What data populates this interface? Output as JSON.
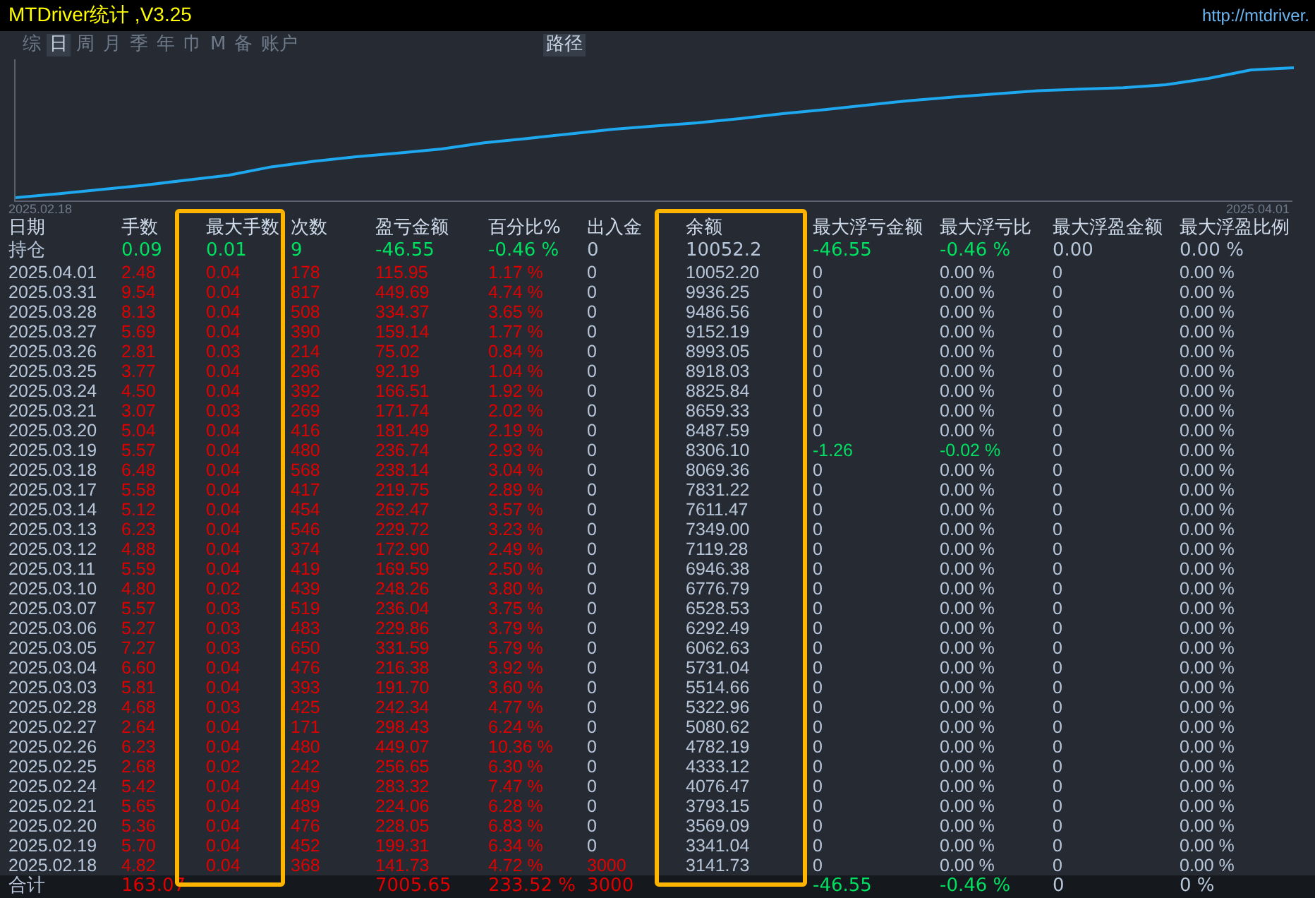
{
  "window": {
    "title": "MTDriver统计 ,V3.25",
    "url": "http://mtdriver."
  },
  "tabs": [
    {
      "label": "综",
      "selected": false
    },
    {
      "label": "日",
      "selected": true
    },
    {
      "label": "周",
      "selected": false
    },
    {
      "label": "月",
      "selected": false
    },
    {
      "label": "季",
      "selected": false
    },
    {
      "label": "年",
      "selected": false
    },
    {
      "label": "巾",
      "selected": false
    },
    {
      "label": "M",
      "selected": false
    },
    {
      "label": "备",
      "selected": false
    },
    {
      "label": "账户",
      "selected": false
    }
  ],
  "path_button": {
    "label": "路径",
    "selected": true
  },
  "chart": {
    "start_label": "2025.02.18",
    "end_label": "2025.04.01"
  },
  "table": {
    "columns": [
      {
        "label": "日期",
        "highlighted": false
      },
      {
        "label": "手数",
        "highlighted": false
      },
      {
        "label": "最大手数",
        "highlighted": true
      },
      {
        "label": "次数",
        "highlighted": false
      },
      {
        "label": "盈亏金额",
        "highlighted": false
      },
      {
        "label": "百分比%",
        "highlighted": false
      },
      {
        "label": "出入金",
        "highlighted": false
      },
      {
        "label": "余额",
        "highlighted": true
      },
      {
        "label": "最大浮亏金额",
        "highlighted": false
      },
      {
        "label": "最大浮亏比",
        "highlighted": false
      },
      {
        "label": "最大浮盈金额",
        "highlighted": false
      },
      {
        "label": "最大浮盈比例",
        "highlighted": false
      }
    ],
    "rows": [
      {
        "kind": "position",
        "cells": [
          "持仓",
          "0.09",
          "0.01",
          "9",
          "-46.55",
          "-0.46 %",
          "0",
          "10052.2",
          "-46.55",
          "-0.46 %",
          "0.00",
          "0.00 %"
        ]
      },
      {
        "kind": "day",
        "cells": [
          "2025.04.01",
          "2.48",
          "0.04",
          "178",
          "115.95",
          "1.17 %",
          "0",
          "10052.20",
          "0",
          "0.00 %",
          "0",
          "0.00 %"
        ]
      },
      {
        "kind": "day",
        "cells": [
          "2025.03.31",
          "9.54",
          "0.04",
          "817",
          "449.69",
          "4.74 %",
          "0",
          "9936.25",
          "0",
          "0.00 %",
          "0",
          "0.00 %"
        ]
      },
      {
        "kind": "day",
        "cells": [
          "2025.03.28",
          "8.13",
          "0.04",
          "508",
          "334.37",
          "3.65 %",
          "0",
          "9486.56",
          "0",
          "0.00 %",
          "0",
          "0.00 %"
        ]
      },
      {
        "kind": "day",
        "cells": [
          "2025.03.27",
          "5.69",
          "0.04",
          "390",
          "159.14",
          "1.77 %",
          "0",
          "9152.19",
          "0",
          "0.00 %",
          "0",
          "0.00 %"
        ]
      },
      {
        "kind": "day",
        "cells": [
          "2025.03.26",
          "2.81",
          "0.03",
          "214",
          "75.02",
          "0.84 %",
          "0",
          "8993.05",
          "0",
          "0.00 %",
          "0",
          "0.00 %"
        ]
      },
      {
        "kind": "day",
        "cells": [
          "2025.03.25",
          "3.77",
          "0.04",
          "296",
          "92.19",
          "1.04 %",
          "0",
          "8918.03",
          "0",
          "0.00 %",
          "0",
          "0.00 %"
        ]
      },
      {
        "kind": "day",
        "cells": [
          "2025.03.24",
          "4.50",
          "0.04",
          "392",
          "166.51",
          "1.92 %",
          "0",
          "8825.84",
          "0",
          "0.00 %",
          "0",
          "0.00 %"
        ]
      },
      {
        "kind": "day",
        "cells": [
          "2025.03.21",
          "3.07",
          "0.03",
          "269",
          "171.74",
          "2.02 %",
          "0",
          "8659.33",
          "0",
          "0.00 %",
          "0",
          "0.00 %"
        ]
      },
      {
        "kind": "day",
        "cells": [
          "2025.03.20",
          "5.04",
          "0.04",
          "416",
          "181.49",
          "2.19 %",
          "0",
          "8487.59",
          "0",
          "0.00 %",
          "0",
          "0.00 %"
        ]
      },
      {
        "kind": "day",
        "floating_loss": true,
        "cells": [
          "2025.03.19",
          "5.57",
          "0.04",
          "480",
          "236.74",
          "2.93 %",
          "0",
          "8306.10",
          "-1.26",
          "-0.02 %",
          "0",
          "0.00 %"
        ]
      },
      {
        "kind": "day",
        "cells": [
          "2025.03.18",
          "6.48",
          "0.04",
          "568",
          "238.14",
          "3.04 %",
          "0",
          "8069.36",
          "0",
          "0.00 %",
          "0",
          "0.00 %"
        ]
      },
      {
        "kind": "day",
        "cells": [
          "2025.03.17",
          "5.58",
          "0.04",
          "417",
          "219.75",
          "2.89 %",
          "0",
          "7831.22",
          "0",
          "0.00 %",
          "0",
          "0.00 %"
        ]
      },
      {
        "kind": "day",
        "cells": [
          "2025.03.14",
          "5.12",
          "0.04",
          "454",
          "262.47",
          "3.57 %",
          "0",
          "7611.47",
          "0",
          "0.00 %",
          "0",
          "0.00 %"
        ]
      },
      {
        "kind": "day",
        "cells": [
          "2025.03.13",
          "6.23",
          "0.04",
          "546",
          "229.72",
          "3.23 %",
          "0",
          "7349.00",
          "0",
          "0.00 %",
          "0",
          "0.00 %"
        ]
      },
      {
        "kind": "day",
        "cells": [
          "2025.03.12",
          "4.88",
          "0.04",
          "374",
          "172.90",
          "2.49 %",
          "0",
          "7119.28",
          "0",
          "0.00 %",
          "0",
          "0.00 %"
        ]
      },
      {
        "kind": "day",
        "cells": [
          "2025.03.11",
          "5.59",
          "0.04",
          "419",
          "169.59",
          "2.50 %",
          "0",
          "6946.38",
          "0",
          "0.00 %",
          "0",
          "0.00 %"
        ]
      },
      {
        "kind": "day",
        "cells": [
          "2025.03.10",
          "4.80",
          "0.02",
          "439",
          "248.26",
          "3.80 %",
          "0",
          "6776.79",
          "0",
          "0.00 %",
          "0",
          "0.00 %"
        ]
      },
      {
        "kind": "day",
        "cells": [
          "2025.03.07",
          "5.57",
          "0.03",
          "519",
          "236.04",
          "3.75 %",
          "0",
          "6528.53",
          "0",
          "0.00 %",
          "0",
          "0.00 %"
        ]
      },
      {
        "kind": "day",
        "cells": [
          "2025.03.06",
          "5.27",
          "0.03",
          "483",
          "229.86",
          "3.79 %",
          "0",
          "6292.49",
          "0",
          "0.00 %",
          "0",
          "0.00 %"
        ]
      },
      {
        "kind": "day",
        "cells": [
          "2025.03.05",
          "7.27",
          "0.03",
          "650",
          "331.59",
          "5.79 %",
          "0",
          "6062.63",
          "0",
          "0.00 %",
          "0",
          "0.00 %"
        ]
      },
      {
        "kind": "day",
        "cells": [
          "2025.03.04",
          "6.60",
          "0.04",
          "476",
          "216.38",
          "3.92 %",
          "0",
          "5731.04",
          "0",
          "0.00 %",
          "0",
          "0.00 %"
        ]
      },
      {
        "kind": "day",
        "cells": [
          "2025.03.03",
          "5.81",
          "0.04",
          "393",
          "191.70",
          "3.60 %",
          "0",
          "5514.66",
          "0",
          "0.00 %",
          "0",
          "0.00 %"
        ]
      },
      {
        "kind": "day",
        "cells": [
          "2025.02.28",
          "4.68",
          "0.03",
          "425",
          "242.34",
          "4.77 %",
          "0",
          "5322.96",
          "0",
          "0.00 %",
          "0",
          "0.00 %"
        ]
      },
      {
        "kind": "day",
        "cells": [
          "2025.02.27",
          "2.64",
          "0.04",
          "171",
          "298.43",
          "6.24 %",
          "0",
          "5080.62",
          "0",
          "0.00 %",
          "0",
          "0.00 %"
        ]
      },
      {
        "kind": "day",
        "cells": [
          "2025.02.26",
          "6.23",
          "0.04",
          "480",
          "449.07",
          "10.36 %",
          "0",
          "4782.19",
          "0",
          "0.00 %",
          "0",
          "0.00 %"
        ]
      },
      {
        "kind": "day",
        "cells": [
          "2025.02.25",
          "2.68",
          "0.02",
          "242",
          "256.65",
          "6.30 %",
          "0",
          "4333.12",
          "0",
          "0.00 %",
          "0",
          "0.00 %"
        ]
      },
      {
        "kind": "day",
        "cells": [
          "2025.02.24",
          "5.42",
          "0.04",
          "449",
          "283.32",
          "7.47 %",
          "0",
          "4076.47",
          "0",
          "0.00 %",
          "0",
          "0.00 %"
        ]
      },
      {
        "kind": "day",
        "cells": [
          "2025.02.21",
          "5.65",
          "0.04",
          "489",
          "224.06",
          "6.28 %",
          "0",
          "3793.15",
          "0",
          "0.00 %",
          "0",
          "0.00 %"
        ]
      },
      {
        "kind": "day",
        "cells": [
          "2025.02.20",
          "5.36",
          "0.04",
          "476",
          "228.05",
          "6.83 %",
          "0",
          "3569.09",
          "0",
          "0.00 %",
          "0",
          "0.00 %"
        ]
      },
      {
        "kind": "day",
        "cells": [
          "2025.02.19",
          "5.70",
          "0.04",
          "452",
          "199.31",
          "6.34 %",
          "0",
          "3341.04",
          "0",
          "0.00 %",
          "0",
          "0.00 %"
        ]
      },
      {
        "kind": "day",
        "deposit": true,
        "cells": [
          "2025.02.18",
          "4.82",
          "0.04",
          "368",
          "141.73",
          "4.72 %",
          "3000",
          "3141.73",
          "0",
          "0.00 %",
          "0",
          "0.00 %"
        ]
      },
      {
        "kind": "total",
        "cells": [
          "合计",
          "163.07",
          null,
          null,
          "7005.65",
          "233.52 %",
          "3000",
          null,
          "-46.55",
          "-0.46 %",
          "0",
          "0 %"
        ]
      }
    ]
  }
}
